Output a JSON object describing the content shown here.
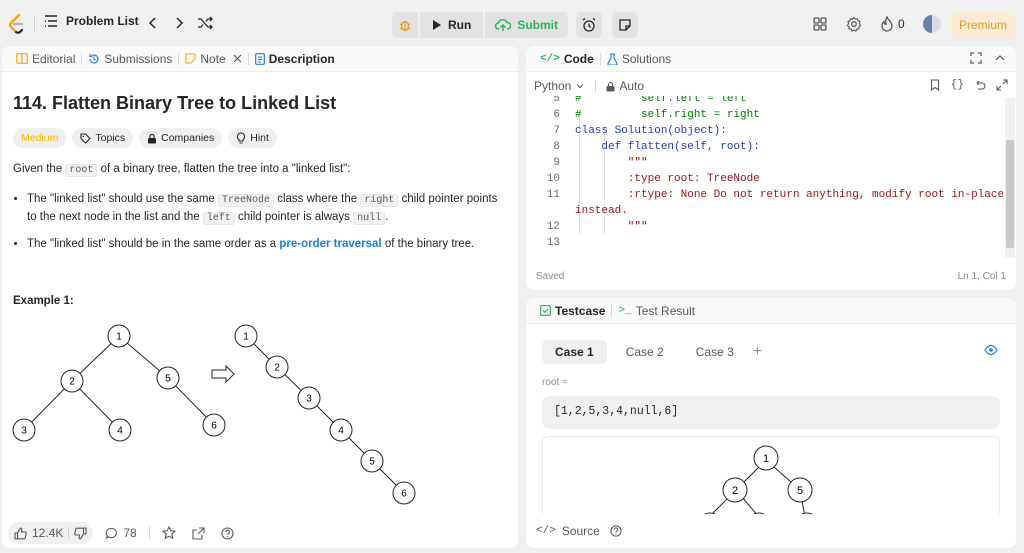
{
  "topbar": {
    "problem_list": "Problem List",
    "run": "Run",
    "submit": "Submit",
    "streak": "0",
    "premium": "Premium"
  },
  "left_tabs": {
    "editorial": "Editorial",
    "submissions": "Submissions",
    "note": "Note",
    "description": "Description"
  },
  "problem": {
    "title": "114. Flatten Binary Tree to Linked List",
    "difficulty": "Medium",
    "topics": "Topics",
    "companies": "Companies",
    "hint": "Hint",
    "intro_a": "Given the ",
    "intro_code": "root",
    "intro_b": " of a binary tree, flatten the tree into a \"linked list\":",
    "b1_a": "The \"linked list\" should use the same ",
    "b1_code1": "TreeNode",
    "b1_b": " class where the ",
    "b1_code2": "right",
    "b1_c": " child pointer points to the next node in the list and the ",
    "b1_code3": "left",
    "b1_d": " child pointer is always ",
    "b1_code4": "null",
    "b1_e": ".",
    "b2_a": "The \"linked list\" should be in the same order as a ",
    "b2_link": "pre-order traversal",
    "b2_b": " of the binary tree.",
    "example_heading": "Example 1:"
  },
  "example_tree": {
    "input_nodes": [
      "1",
      "2",
      "5",
      "3",
      "4",
      "6"
    ],
    "output_nodes": [
      "1",
      "2",
      "3",
      "4",
      "5",
      "6"
    ]
  },
  "footer": {
    "likes": "12.4K",
    "comments": "78"
  },
  "code_panel": {
    "tab_code": "Code",
    "tab_solutions": "Solutions",
    "language": "Python",
    "mode": "Auto",
    "saved": "Saved",
    "cursor": "Ln 1, Col 1",
    "lines": [
      {
        "n": "5",
        "text": "#         self.left = left"
      },
      {
        "n": "6",
        "text": "#         self.right = right"
      },
      {
        "n": "7",
        "text": "class Solution(object):"
      },
      {
        "n": "8",
        "text": "    def flatten(self, root):"
      },
      {
        "n": "9",
        "text": "        \"\"\""
      },
      {
        "n": "10",
        "text": "        :type root: TreeNode"
      },
      {
        "n": "11",
        "text": "        :rtype: None Do not return anything, modify root in-place"
      },
      {
        "n": "",
        "text": "instead."
      },
      {
        "n": "12",
        "text": "        \"\"\""
      },
      {
        "n": "13",
        "text": ""
      }
    ]
  },
  "test_panel": {
    "tab_testcase": "Testcase",
    "tab_result": "Test Result",
    "cases": [
      "Case 1",
      "Case 2",
      "Case 3"
    ],
    "root_label": "root =",
    "root_value": "[1,2,5,3,4,null,6]",
    "tree_nodes": [
      "1",
      "2",
      "5"
    ],
    "source": "Source"
  },
  "colors": {
    "accent_green": "#2db55d",
    "medium_yellow": "#ffb800",
    "link_blue": "#1a7fe0",
    "premium_orange": "#e39c2c"
  }
}
